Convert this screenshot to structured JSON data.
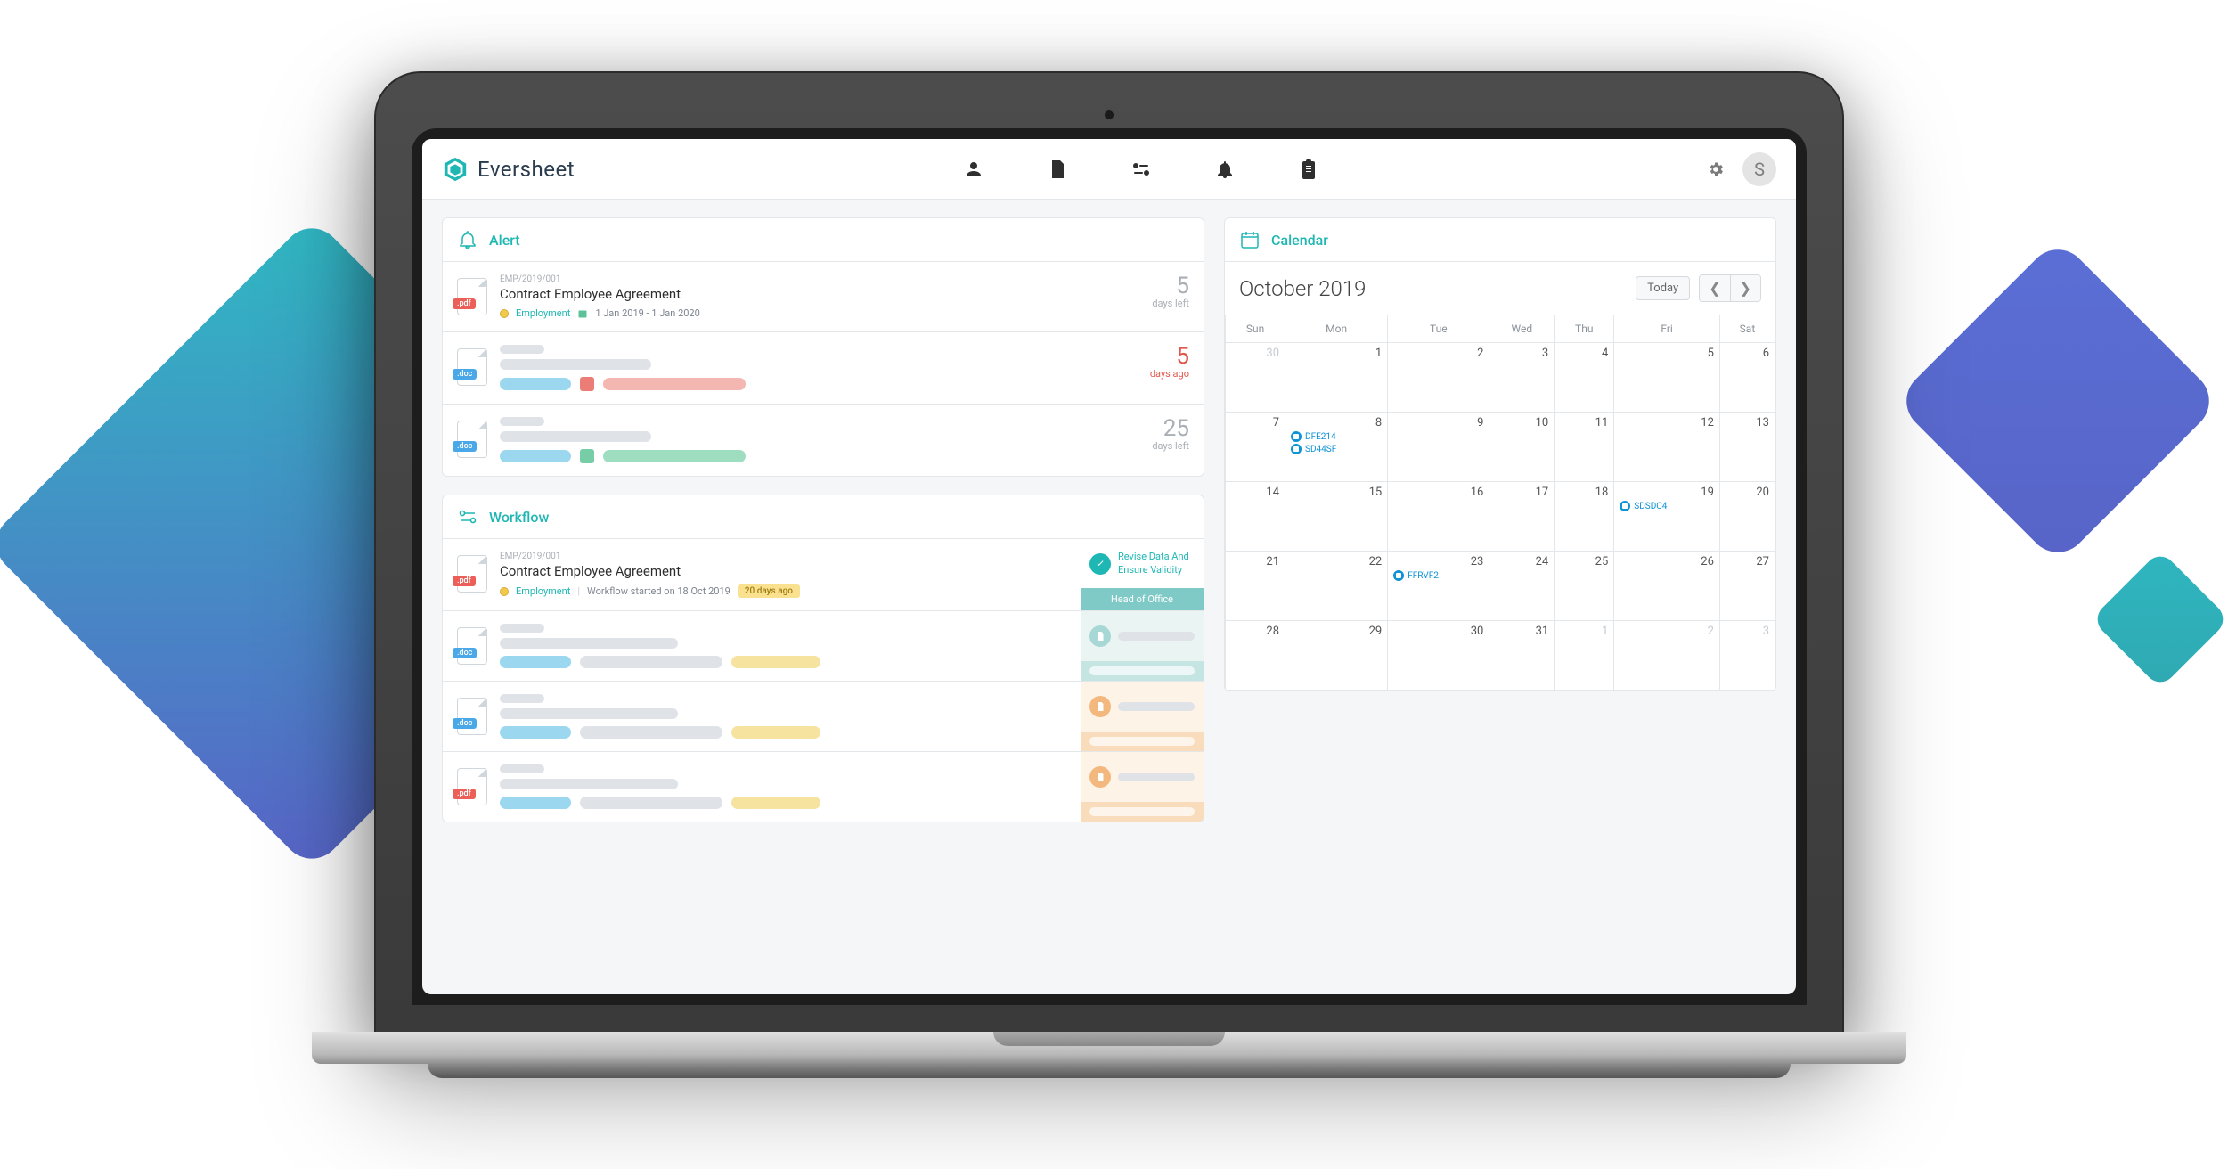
{
  "brand": {
    "name": "Eversheet"
  },
  "header": {
    "avatar_initial": "S"
  },
  "panels": {
    "alert": {
      "title": "Alert"
    },
    "workflow": {
      "title": "Workflow"
    },
    "calendar": {
      "title": "Calendar"
    }
  },
  "alerts": [
    {
      "file_type": "pdf",
      "ref": "EMP/2019/001",
      "title": "Contract Employee Agreement",
      "category": "Employment",
      "date_range": "1 Jan 2019 - 1 Jan 2020",
      "days_num": "5",
      "days_label": "days left",
      "tone": "normal"
    },
    {
      "file_type": "doc",
      "placeholder": true,
      "days_num": "5",
      "days_label": "days ago",
      "tone": "red"
    },
    {
      "file_type": "doc",
      "placeholder": true,
      "days_num": "25",
      "days_label": "days left",
      "tone": "normal"
    }
  ],
  "workflow": [
    {
      "file_type": "pdf",
      "ref": "EMP/2019/001",
      "title": "Contract Employee Agreement",
      "category": "Employment",
      "started": "Workflow started on 18 Oct 2019",
      "badge": "20 days ago",
      "status_text": "Revise Data And Ensure Validity",
      "status_role": "Head of Office",
      "status_tone": "teal"
    },
    {
      "file_type": "doc",
      "placeholder": true,
      "status_tone": "tealg"
    },
    {
      "file_type": "doc",
      "placeholder": true,
      "status_tone": "orange"
    },
    {
      "file_type": "pdf",
      "placeholder": true,
      "status_tone": "orange"
    }
  ],
  "calendar": {
    "month_title": "October 2019",
    "today_label": "Today",
    "weekdays": [
      "Sun",
      "Mon",
      "Tue",
      "Wed",
      "Thu",
      "Fri",
      "Sat"
    ],
    "weeks": [
      [
        {
          "d": "30",
          "out": true
        },
        {
          "d": "1"
        },
        {
          "d": "2"
        },
        {
          "d": "3"
        },
        {
          "d": "4"
        },
        {
          "d": "5"
        },
        {
          "d": "6"
        }
      ],
      [
        {
          "d": "7"
        },
        {
          "d": "8",
          "events": [
            "DFE214",
            "SD44SF"
          ]
        },
        {
          "d": "9"
        },
        {
          "d": "10"
        },
        {
          "d": "11"
        },
        {
          "d": "12"
        },
        {
          "d": "13"
        }
      ],
      [
        {
          "d": "14"
        },
        {
          "d": "15"
        },
        {
          "d": "16"
        },
        {
          "d": "17"
        },
        {
          "d": "18"
        },
        {
          "d": "19",
          "events": [
            "SDSDC4"
          ]
        },
        {
          "d": "20"
        }
      ],
      [
        {
          "d": "21"
        },
        {
          "d": "22"
        },
        {
          "d": "23",
          "events": [
            "FFRVF2"
          ]
        },
        {
          "d": "24"
        },
        {
          "d": "25"
        },
        {
          "d": "26"
        },
        {
          "d": "27"
        }
      ],
      [
        {
          "d": "28"
        },
        {
          "d": "29"
        },
        {
          "d": "30"
        },
        {
          "d": "31"
        },
        {
          "d": "1",
          "out": true
        },
        {
          "d": "2",
          "out": true
        },
        {
          "d": "3",
          "out": true
        }
      ]
    ]
  }
}
